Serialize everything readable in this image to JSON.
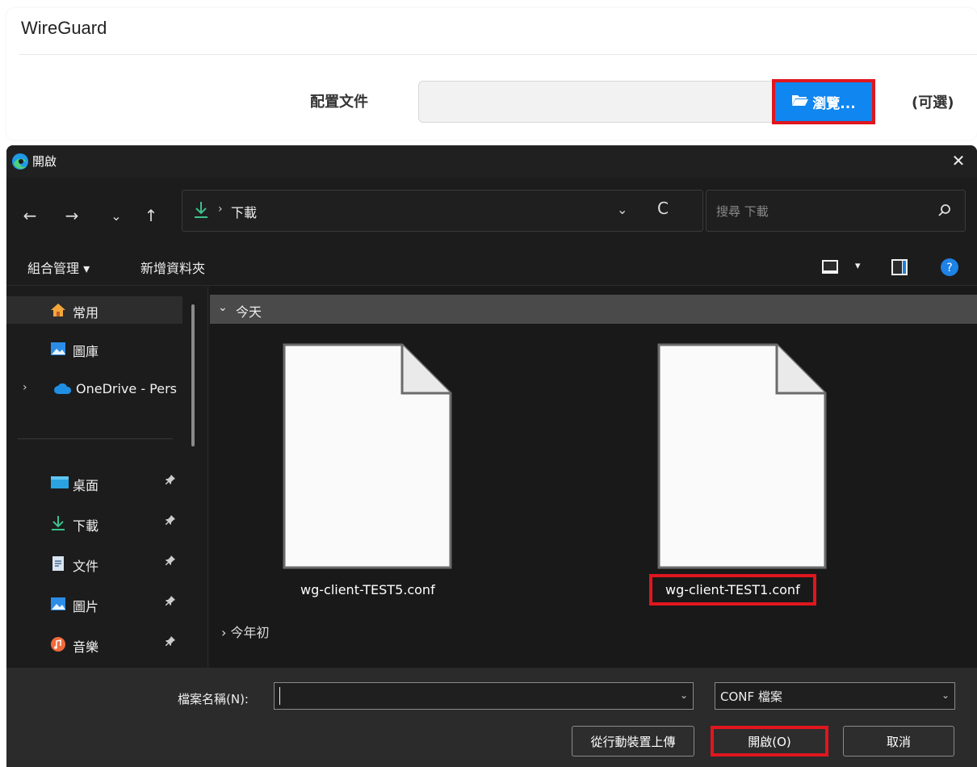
{
  "panel": {
    "title": "WireGuard",
    "config_label": "配置文件",
    "browse_label": "瀏覽...",
    "optional_label": "(可選)"
  },
  "dialog": {
    "title": "開啟",
    "close_glyph": "✕",
    "nav": {
      "back": "←",
      "forward": "→",
      "recent": "⌄",
      "up": "↑"
    },
    "address": {
      "separator": "›",
      "location": "下載",
      "dropdown": "⌄",
      "refresh": "C"
    },
    "search": {
      "placeholder": "搜尋 下載"
    },
    "commands": {
      "organize": "組合管理 ▾",
      "new_folder": "新增資料夾",
      "view_dropdown": "▾"
    },
    "sidebar": {
      "items": [
        {
          "label": "常用",
          "icon": "home-icon"
        },
        {
          "label": "圖庫",
          "icon": "gallery-icon"
        },
        {
          "label": "OneDrive - Pers",
          "icon": "onedrive-cloud-icon"
        },
        {
          "label": "桌面",
          "icon": "desktop-icon"
        },
        {
          "label": "下載",
          "icon": "download-icon"
        },
        {
          "label": "文件",
          "icon": "document-icon"
        },
        {
          "label": "圖片",
          "icon": "pictures-icon"
        },
        {
          "label": "音樂",
          "icon": "music-icon"
        }
      ],
      "chevron": "›",
      "pin_glyph": "📌"
    },
    "groups": {
      "today": {
        "label": "今天",
        "chevron": "⌄"
      },
      "start_of_year": {
        "label": "今年初",
        "chevron": "›"
      }
    },
    "files": [
      {
        "name": "wg-client-TEST5.conf",
        "selected": false
      },
      {
        "name": "wg-client-TEST1.conf",
        "selected": true
      }
    ],
    "bottom": {
      "filename_label": "檔案名稱(N):",
      "filename_value": "",
      "dropdown": "⌄",
      "filetype": "CONF 檔案",
      "upload_button": "從行動裝置上傳",
      "open_button": "開啟(O)",
      "cancel_button": "取消"
    }
  },
  "colors": {
    "accent_blue": "#0f86f0",
    "highlight_red": "#e0161e",
    "dialog_bg": "#1c1c1c",
    "download_green": "#3cc08c"
  }
}
